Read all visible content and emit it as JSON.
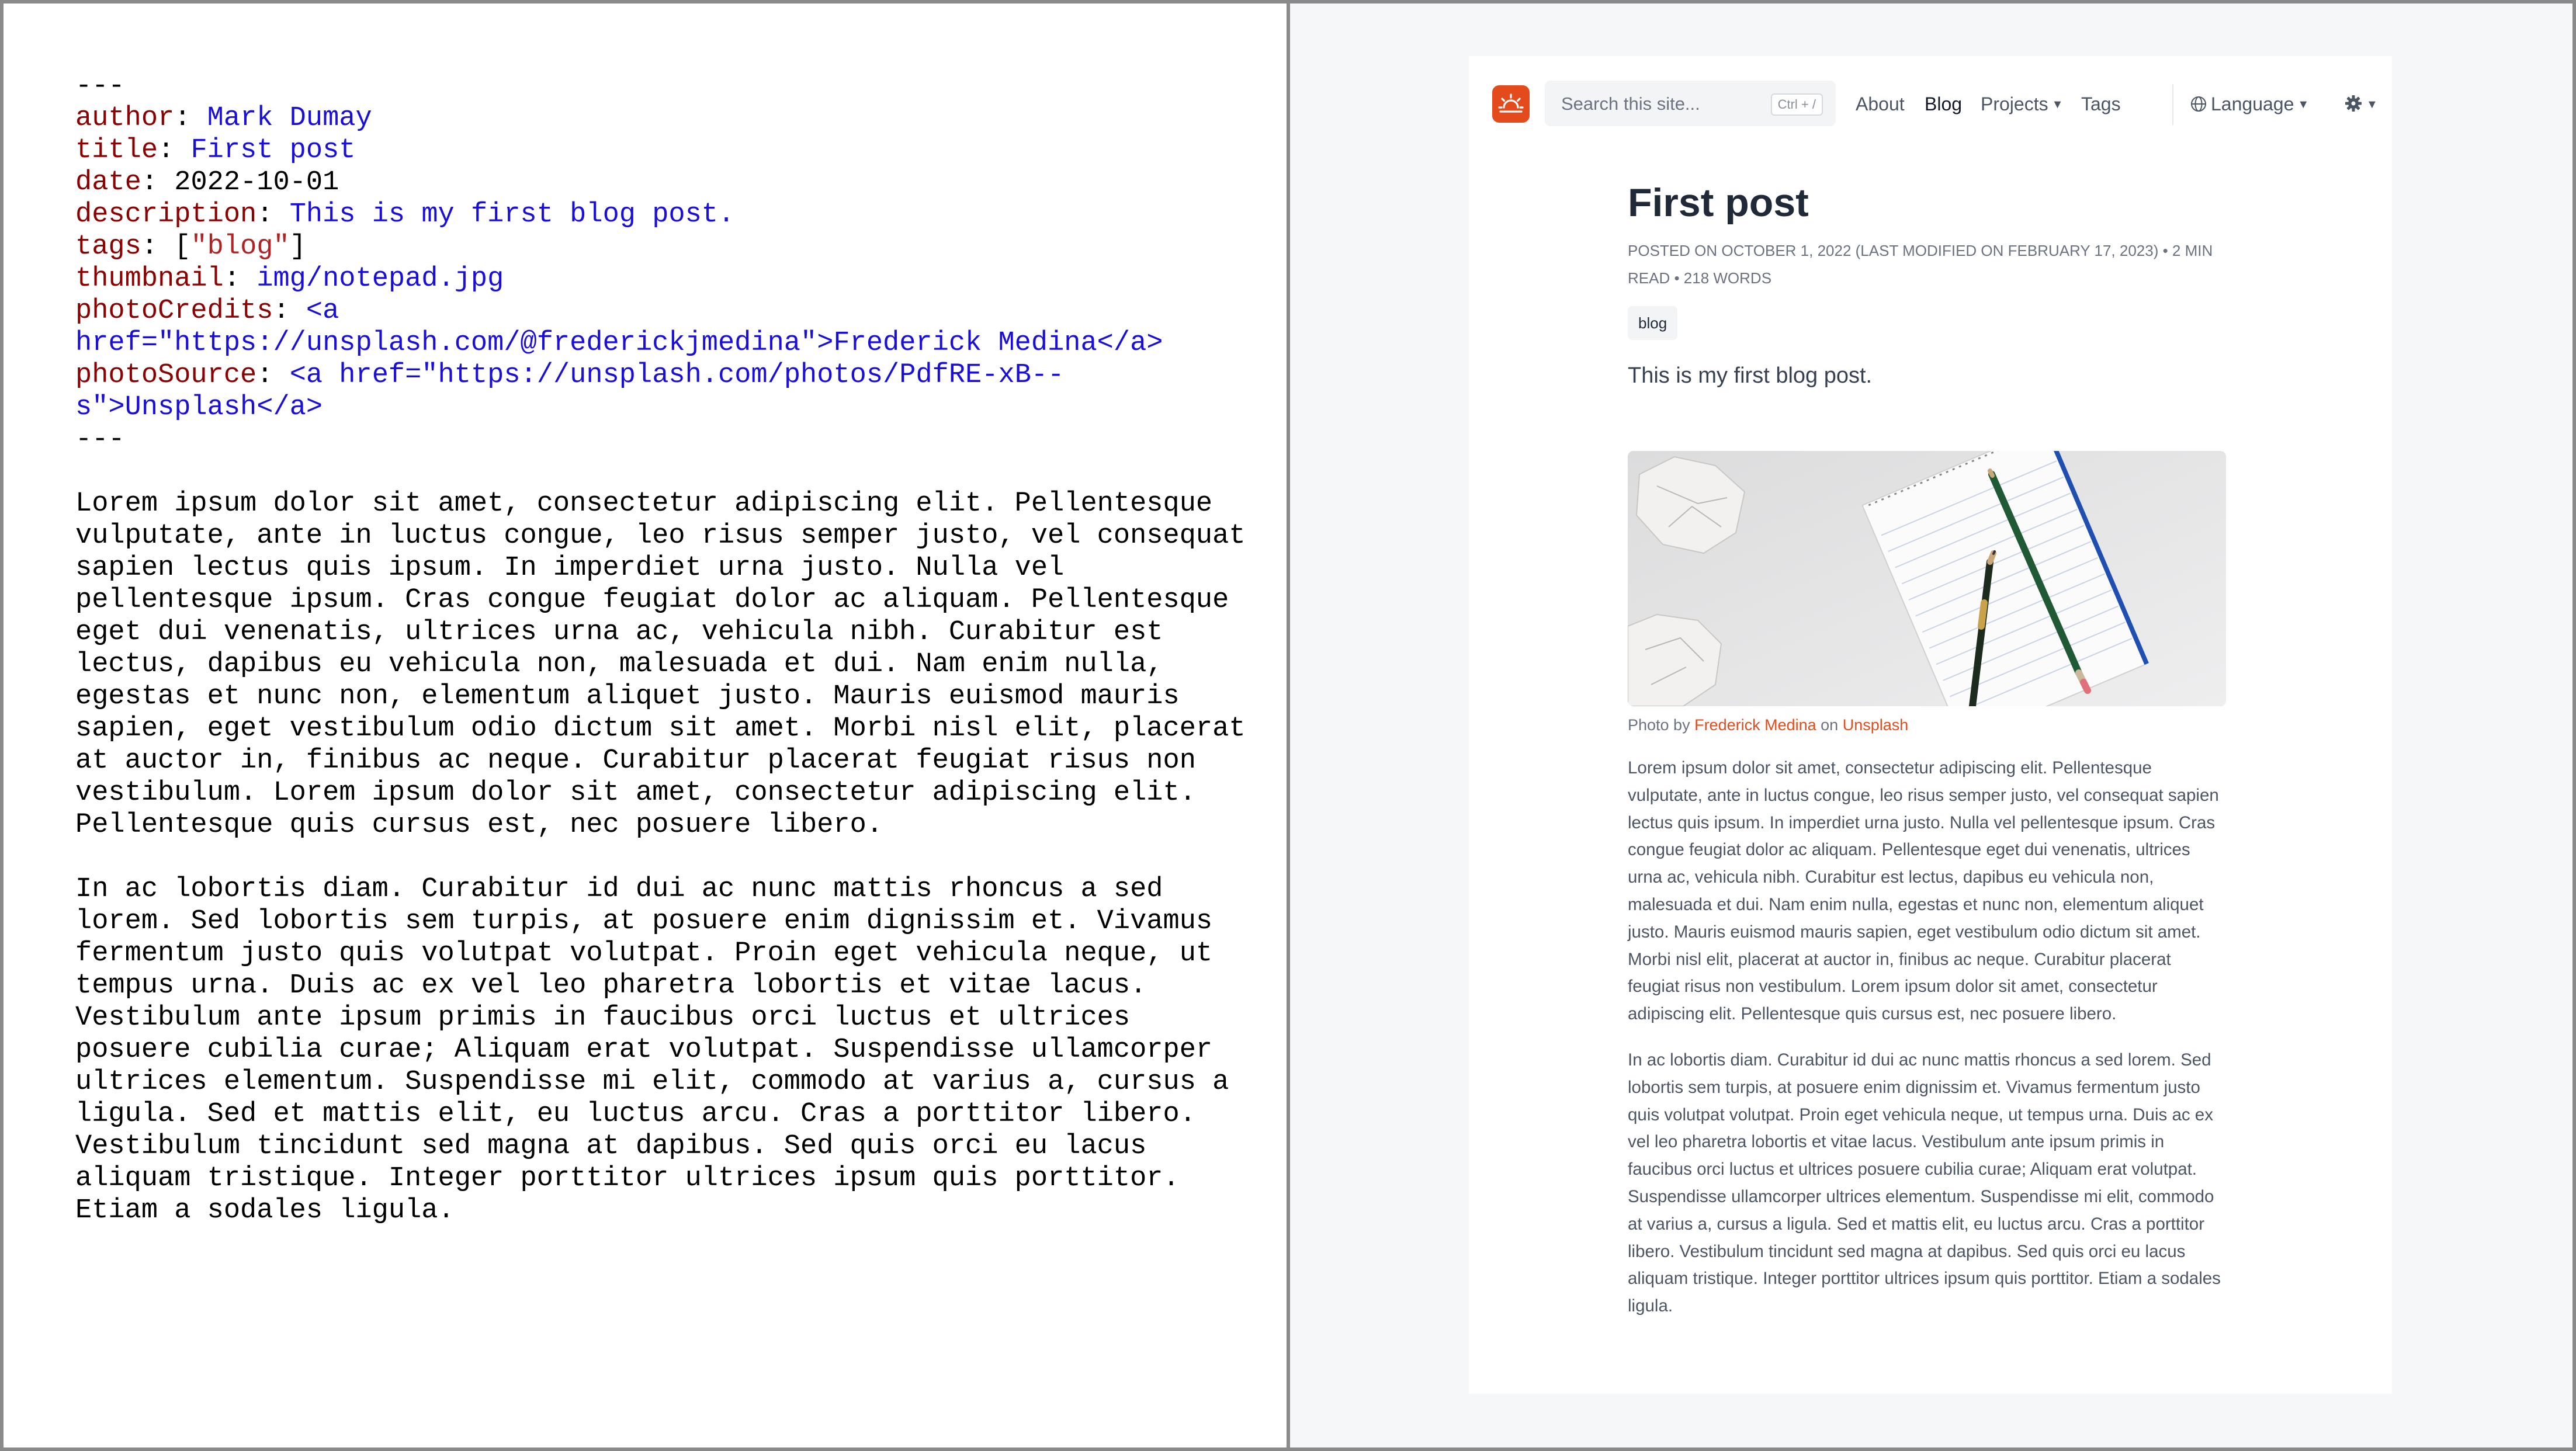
{
  "source": {
    "front_open": "---",
    "fields": [
      {
        "key": "author",
        "value": "Mark Dumay"
      },
      {
        "key": "title",
        "value": "First post"
      },
      {
        "key": "date",
        "value": "2022-10-01"
      },
      {
        "key": "description",
        "value": "This is my first blog post."
      },
      {
        "key": "tags",
        "value_open": "[",
        "value_string": "\"blog\"",
        "value_close": "]"
      },
      {
        "key": "thumbnail",
        "value": "img/notepad.jpg"
      },
      {
        "key": "photoCredits",
        "value_line1": "<a",
        "value_line2": "href=\"https://unsplash.com/@frederickjmedina\">Frederick Medina</a>"
      },
      {
        "key": "photoSource",
        "value_line1": "<a href=\"https://unsplash.com/photos/PdfRE-xB--",
        "value_line2": "s\">Unsplash</a>"
      }
    ],
    "front_close": "---",
    "paragraphs": [
      "Lorem ipsum dolor sit amet, consectetur adipiscing elit. Pellentesque vulputate, ante in luctus congue, leo risus semper justo, vel consequat sapien lectus quis ipsum. In imperdiet urna justo. Nulla vel pellentesque ipsum. Cras congue feugiat dolor ac aliquam. Pellentesque eget dui venenatis, ultrices urna ac, vehicula nibh. Curabitur est lectus, dapibus eu vehicula non, malesuada et dui. Nam enim nulla, egestas et nunc non, elementum aliquet justo. Mauris euismod mauris sapien, eget vestibulum odio dictum sit amet. Morbi nisl elit, placerat at auctor in, finibus ac neque. Curabitur placerat feugiat risus non vestibulum. Lorem ipsum dolor sit amet, consectetur adipiscing elit. Pellentesque quis cursus est, nec posuere libero.",
      "In ac lobortis diam. Curabitur id dui ac nunc mattis rhoncus a sed lorem. Sed lobortis sem turpis, at posuere enim dignissim et. Vivamus fermentum justo quis volutpat volutpat. Proin eget vehicula neque, ut tempus urna. Duis ac ex vel leo pharetra lobortis et vitae lacus. Vestibulum ante ipsum primis in faucibus orci luctus et ultrices posuere cubilia curae; Aliquam erat volutpat. Suspendisse ullamcorper ultrices elementum. Suspendisse mi elit, commodo at varius a, cursus a ligula. Sed et mattis elit, eu luctus arcu. Cras a porttitor libero. Vestibulum tincidunt sed magna at dapibus. Sed quis orci eu lacus aliquam tristique. Integer porttitor ultrices ipsum quis porttitor. Etiam a sodales ligula."
    ]
  },
  "site": {
    "search_placeholder": "Search this site...",
    "search_shortcut": "Ctrl + /",
    "nav": {
      "about": "About",
      "blog": "Blog",
      "projects": "Projects",
      "tags": "Tags",
      "language": "Language"
    },
    "colors": {
      "accent": "#e34a1c",
      "text": "#1f2937",
      "muted": "#6b7280"
    }
  },
  "post": {
    "title": "First post",
    "meta": "Posted on October 1, 2022 (Last modified on February 17, 2023) • 2 min read • 218 words",
    "tag": "blog",
    "description": "This is my first blog post.",
    "credit_prefix": "Photo by ",
    "credit_author": "Frederick Medina",
    "credit_middle": " on ",
    "credit_source": "Unsplash",
    "paragraphs": [
      "Lorem ipsum dolor sit amet, consectetur adipiscing elit. Pellentesque vulputate, ante in luctus congue, leo risus semper justo, vel consequat sapien lectus quis ipsum. In imperdiet urna justo. Nulla vel pellentesque ipsum. Cras congue feugiat dolor ac aliquam. Pellentesque eget dui venenatis, ultrices urna ac, vehicula nibh. Curabitur est lectus, dapibus eu vehicula non, malesuada et dui. Nam enim nulla, egestas et nunc non, elementum aliquet justo. Mauris euismod mauris sapien, eget vestibulum odio dictum sit amet. Morbi nisl elit, placerat at auctor in, finibus ac neque. Curabitur placerat feugiat risus non vestibulum. Lorem ipsum dolor sit amet, consectetur adipiscing elit. Pellentesque quis cursus est, nec posuere libero.",
      "In ac lobortis diam. Curabitur id dui ac nunc mattis rhoncus a sed lorem. Sed lobortis sem turpis, at posuere enim dignissim et. Vivamus fermentum justo quis volutpat volutpat. Proin eget vehicula neque, ut tempus urna. Duis ac ex vel leo pharetra lobortis et vitae lacus. Vestibulum ante ipsum primis in faucibus orci luctus et ultrices posuere cubilia curae; Aliquam erat volutpat. Suspendisse ullamcorper ultrices elementum. Suspendisse mi elit, commodo at varius a, cursus a ligula. Sed et mattis elit, eu luctus arcu. Cras a porttitor libero. Vestibulum tincidunt sed magna at dapibus. Sed quis orci eu lacus aliquam tristique. Integer porttitor ultrices ipsum quis porttitor. Etiam a sodales ligula."
    ]
  }
}
